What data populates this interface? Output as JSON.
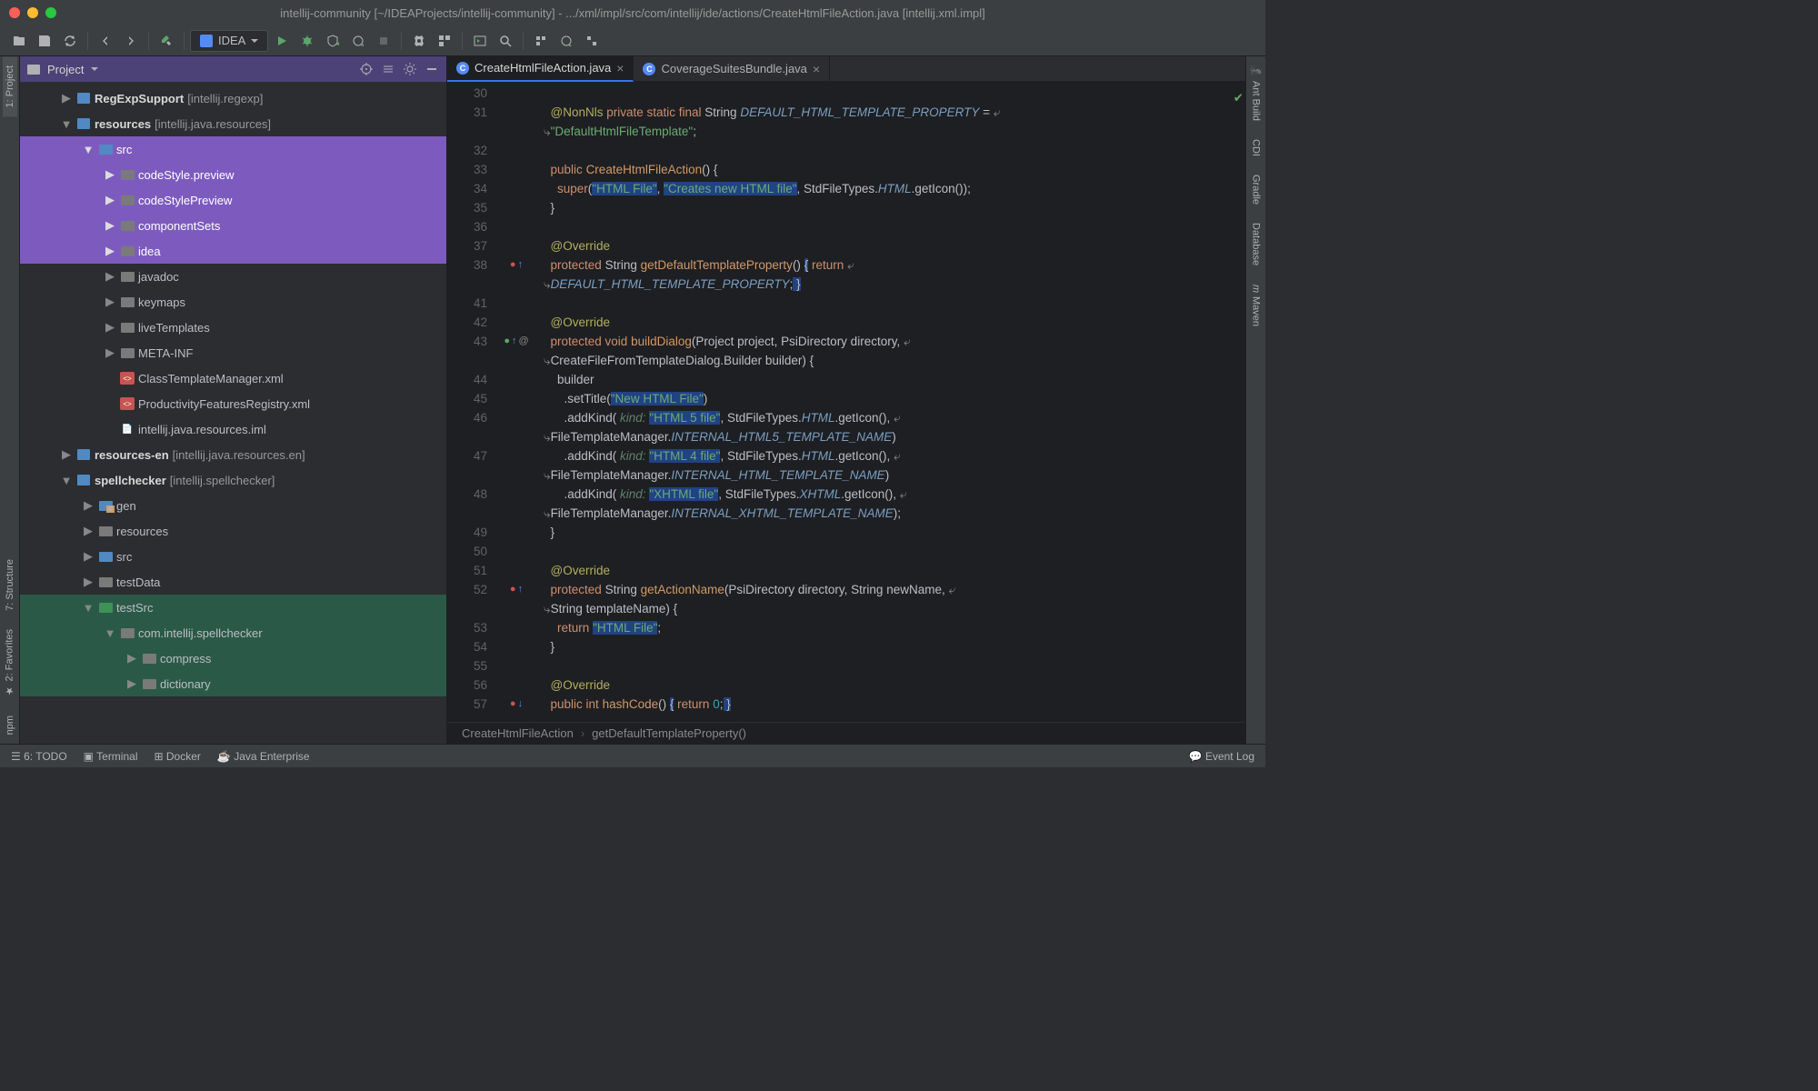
{
  "title": "intellij-community [~/IDEAProjects/intellij-community] - .../xml/impl/src/com/intellij/ide/actions/CreateHtmlFileAction.java [intellij.xml.impl]",
  "runConfig": "IDEA",
  "panel": {
    "title": "Project"
  },
  "tree": [
    {
      "indent": 1,
      "exp": "▶",
      "icon": "module",
      "label": "RegExpSupport",
      "suffix": "[intellij.regexp]",
      "cls": ""
    },
    {
      "indent": 1,
      "exp": "▼",
      "icon": "module",
      "label": "resources",
      "suffix": "[intellij.java.resources]",
      "cls": ""
    },
    {
      "indent": 2,
      "exp": "▼",
      "icon": "folder-blue",
      "label": "src",
      "cls": "purple"
    },
    {
      "indent": 3,
      "exp": "▶",
      "icon": "folder-gray",
      "label": "codeStyle.preview",
      "cls": "purple"
    },
    {
      "indent": 3,
      "exp": "▶",
      "icon": "folder-gray",
      "label": "codeStylePreview",
      "cls": "purple"
    },
    {
      "indent": 3,
      "exp": "▶",
      "icon": "folder-gray",
      "label": "componentSets",
      "cls": "purple"
    },
    {
      "indent": 3,
      "exp": "▶",
      "icon": "folder-gray",
      "label": "idea",
      "cls": "purple"
    },
    {
      "indent": 3,
      "exp": "▶",
      "icon": "folder-gray",
      "label": "javadoc",
      "cls": ""
    },
    {
      "indent": 3,
      "exp": "▶",
      "icon": "folder-gray",
      "label": "keymaps",
      "cls": ""
    },
    {
      "indent": 3,
      "exp": "▶",
      "icon": "folder-gray",
      "label": "liveTemplates",
      "cls": ""
    },
    {
      "indent": 3,
      "exp": "▶",
      "icon": "folder-gray",
      "label": "META-INF",
      "cls": ""
    },
    {
      "indent": 3,
      "exp": "",
      "icon": "xml",
      "label": "ClassTemplateManager.xml",
      "cls": ""
    },
    {
      "indent": 3,
      "exp": "",
      "icon": "xml",
      "label": "ProductivityFeaturesRegistry.xml",
      "cls": ""
    },
    {
      "indent": 3,
      "exp": "",
      "icon": "iml",
      "label": "intellij.java.resources.iml",
      "cls": ""
    },
    {
      "indent": 1,
      "exp": "▶",
      "icon": "module",
      "label": "resources-en",
      "suffix": "[intellij.java.resources.en]",
      "cls": ""
    },
    {
      "indent": 1,
      "exp": "▼",
      "icon": "module",
      "label": "spellchecker",
      "suffix": "[intellij.spellchecker]",
      "cls": ""
    },
    {
      "indent": 2,
      "exp": "▶",
      "icon": "folder-gen",
      "label": "gen",
      "cls": ""
    },
    {
      "indent": 2,
      "exp": "▶",
      "icon": "folder-gray",
      "label": "resources",
      "cls": ""
    },
    {
      "indent": 2,
      "exp": "▶",
      "icon": "folder-blue",
      "label": "src",
      "cls": ""
    },
    {
      "indent": 2,
      "exp": "▶",
      "icon": "folder-gray",
      "label": "testData",
      "cls": ""
    },
    {
      "indent": 2,
      "exp": "▼",
      "icon": "folder-green",
      "label": "testSrc",
      "cls": "green"
    },
    {
      "indent": 3,
      "exp": "▼",
      "icon": "folder-gray",
      "label": "com.intellij.spellchecker",
      "cls": "green"
    },
    {
      "indent": 4,
      "exp": "▶",
      "icon": "folder-gray",
      "label": "compress",
      "cls": "green"
    },
    {
      "indent": 4,
      "exp": "▶",
      "icon": "folder-gray",
      "label": "dictionary",
      "cls": "green"
    }
  ],
  "tabs": [
    {
      "label": "CreateHtmlFileAction.java",
      "active": true
    },
    {
      "label": "CoverageSuitesBundle.java",
      "active": false
    }
  ],
  "gutter": [
    "30",
    "31",
    "",
    "32",
    "33",
    "34",
    "35",
    "36",
    "37",
    "38",
    "",
    "41",
    "42",
    "43",
    "",
    "44",
    "45",
    "46",
    "",
    "47",
    "",
    "48",
    "",
    "49",
    "50",
    "51",
    "52",
    "",
    "53",
    "54",
    "55",
    "56",
    "57"
  ],
  "breadcrumb": {
    "a": "CreateHtmlFileAction",
    "b": "getDefaultTemplateProperty()"
  },
  "status": {
    "todo": "6: TODO",
    "term": "Terminal",
    "docker": "Docker",
    "je": "Java Enterprise",
    "event": "Event Log"
  },
  "leftTools": [
    "1: Project",
    "7: Structure",
    "2: Favorites",
    "npm"
  ],
  "rightTools": [
    "Ant Build",
    "CDI",
    "Gradle",
    "Database",
    "Maven"
  ]
}
